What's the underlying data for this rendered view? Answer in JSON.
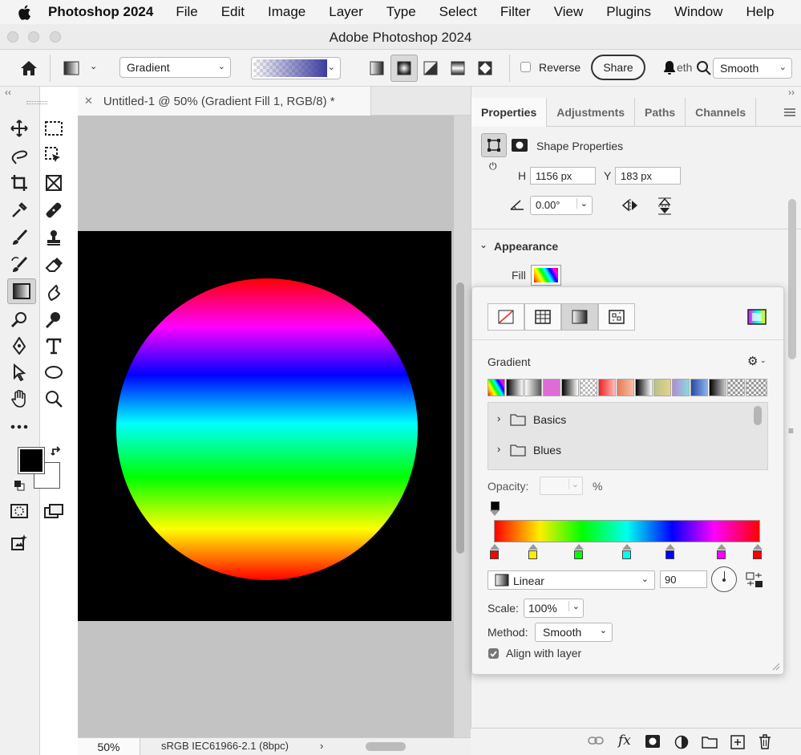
{
  "menubar": {
    "app_name": "Photoshop 2024",
    "items": [
      "File",
      "Edit",
      "Image",
      "Layer",
      "Type",
      "Select",
      "Filter",
      "View",
      "Plugins",
      "Window",
      "Help"
    ]
  },
  "titlebar": {
    "title": "Adobe Photoshop 2024"
  },
  "options": {
    "preset_label": "Gradient",
    "reverse_label": "Reverse",
    "share_label": "Share",
    "method_partial": "eth",
    "method_value": "Smooth"
  },
  "document": {
    "tab_title": "Untitled-1 @ 50% (Gradient Fill 1, RGB/8) *",
    "zoom": "50%",
    "profile": "sRGB IEC61966-2.1 (8bpc)"
  },
  "properties": {
    "tabs": [
      "Properties",
      "Adjustments",
      "Paths",
      "Channels"
    ],
    "header": "Shape Properties",
    "h_label": "H",
    "h_value": "1156 px",
    "y_label": "Y",
    "y_value": "183 px",
    "angle_value": "0.00°",
    "appearance_label": "Appearance",
    "fill_label": "Fill"
  },
  "gradient_popup": {
    "section_label": "Gradient",
    "folders": [
      "Basics",
      "Blues"
    ],
    "opacity_label": "Opacity:",
    "opacity_unit": "%",
    "type_value": "Linear",
    "angle_value": "90",
    "scale_label": "Scale:",
    "scale_value": "100%",
    "method_label": "Method:",
    "method_value": "Smooth",
    "align_label": "Align with layer",
    "align_checked": true,
    "stop_colors": [
      "#ff0000",
      "#ffee00",
      "#00ff00",
      "#00ffee",
      "#0000ff",
      "#ff00ff",
      "#ff0000"
    ]
  },
  "colors": {
    "foreground": "#000000",
    "background": "#ffffff"
  }
}
